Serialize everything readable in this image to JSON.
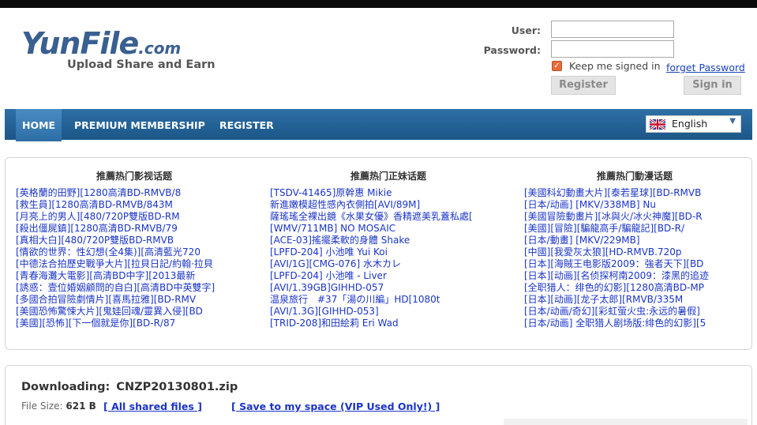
{
  "logo": {
    "word": "YunFile",
    "domain": ".com",
    "tagline": "Upload Share and Earn"
  },
  "login": {
    "user_label": "User:",
    "password_label": "Password:",
    "keep_signed": "Keep me signed in",
    "forget": "forget Password",
    "register_button": "Register",
    "signin_button": "Sign in"
  },
  "nav": {
    "items": [
      "HOME",
      "PREMIUM MEMBERSHIP",
      "REGISTER"
    ],
    "language": "English"
  },
  "columns": [
    {
      "title": "推薦热门影视话题",
      "links": [
        "[英格蘭的田野][1280高清BD-RMVB/8",
        "[救生員][1280高清BD-RMVB/843M",
        "[月亮上的男人][480/720P雙版BD-RM",
        "[殺出僵屍鎮][1280高清BD-RMVB/79",
        "[真相大白][480/720P雙版BD-RMVB",
        "[情欲的世界：性幻想(全4集)][高清藍光720",
        "[中德法合拍歷史戰爭大片][拉貝日記/約翰·拉貝",
        "[青春海灘大電影][高清BD中字][2013最新",
        "[誘惑：壹位婚姻顧問的自白][高清BD中英雙字]",
        "[多國合拍冒險劇情片][喜馬拉雅][BD-RMV",
        "[美國恐怖驚悚大片][鬼娃回魂/靈異入侵][BD",
        "[美國][恐怖][下一個就是你][BD-R/87"
      ]
    },
    {
      "title": "推薦热门正妹话题",
      "links": [
        "[TSDV-41465]原幹惠 Mikie",
        "新進嫩模超性感內衣側拍[AVI/89M]",
        "薩瑤瑤全裸出鏡《水果女優》香精遮美乳蓋私處[",
        "[WMV/711MB] NO MOSAIC",
        "[ACE-03]搖擺柔軟的身體 Shake",
        "[LPFD-204] 小池唯 Yui Koi",
        "[AVI/1G][CMG-076] 水木カレ",
        "[LPFD-204] 小池唯 - Liver",
        "[AVI/1.39GB]GIHHD-057",
        "温泉旅行　#37「湯の川編」HD[1080t",
        "[AVI/1.3G][GIHHD-053]",
        "[TRID-208]和田絵莉 Eri Wad"
      ]
    },
    {
      "title": "推薦热门動漫话题",
      "links": [
        "[美國科幻動畫大片][泰若星球][BD-RMVB",
        "[日本/动画] [MKV/338MB] Nu",
        "[美國冒險動畫片][冰與火/冰火神魔][BD-R",
        "[美國][冒險][騙龍高手/騙龍記][BD-R/",
        "[日本/動畫] [MKV/229MB]",
        "[中國][我愛灰太狼][HD-RMVB.720p",
        "[日本][海賊王电影版2009：強者天下][BD",
        "[日本][动画][名侦探柯南2009：漆黑的追迹",
        "[全职猎人：绯色的幻影][1280高清BD-MP",
        "[日本][动画][龙子太郎][RMVB/335M",
        "[日本/动画/奇幻][彩虹萤火虫:永远的暑假]",
        "[日本/动画] 全职猎人剧场版:绯色的幻影][5"
      ]
    }
  ],
  "download": {
    "label": "Downloading:",
    "filename": "CNZP20130801.zip",
    "size_label": "File Size:",
    "size_value": "621 B",
    "all_shared": "[ All shared files ]",
    "save_space": "[ Save to my space (VIP Used Only!) ]"
  },
  "colors": {
    "nav": "#1f5b8e",
    "link": "#1a34c8",
    "logo": "#3a5f91"
  }
}
